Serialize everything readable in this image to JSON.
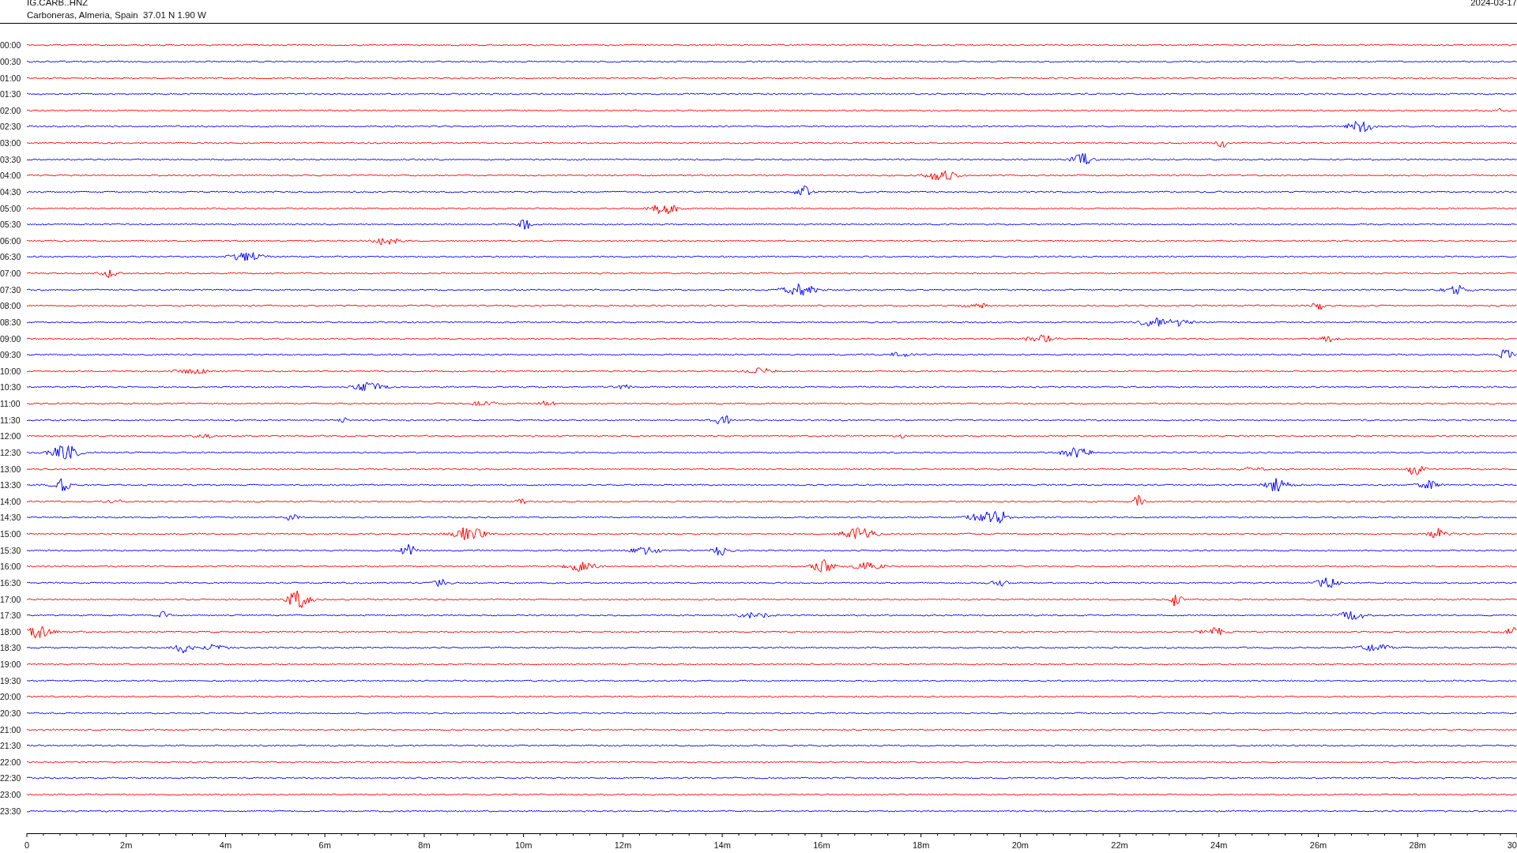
{
  "header": {
    "station": "IG.CARB..HNZ",
    "location": "Carboneras, Almeria, Spain  37.01 N 1.90 W",
    "date": "2024-03-17"
  },
  "traces": [
    {
      "time": "00:00",
      "color": "#ff0000"
    },
    {
      "time": "00:30",
      "color": "#0000ff"
    },
    {
      "time": "01:00",
      "color": "#ff0000"
    },
    {
      "time": "01:30",
      "color": "#0000ff"
    },
    {
      "time": "02:00",
      "color": "#ff0000"
    },
    {
      "time": "02:30",
      "color": "#0000ff"
    },
    {
      "time": "03:00",
      "color": "#ff0000"
    },
    {
      "time": "03:30",
      "color": "#0000ff"
    },
    {
      "time": "04:00",
      "color": "#ff0000"
    },
    {
      "time": "04:30",
      "color": "#0000ff"
    },
    {
      "time": "05:00",
      "color": "#ff0000"
    },
    {
      "time": "05:30",
      "color": "#0000ff"
    },
    {
      "time": "06:00",
      "color": "#ff0000"
    },
    {
      "time": "06:30",
      "color": "#0000ff"
    },
    {
      "time": "07:00",
      "color": "#ff0000"
    },
    {
      "time": "07:30",
      "color": "#0000ff"
    },
    {
      "time": "08:00",
      "color": "#ff0000"
    },
    {
      "time": "08:30",
      "color": "#0000ff"
    },
    {
      "time": "09:00",
      "color": "#ff0000"
    },
    {
      "time": "09:30",
      "color": "#0000ff"
    },
    {
      "time": "10:00",
      "color": "#ff0000"
    },
    {
      "time": "10:30",
      "color": "#0000ff"
    },
    {
      "time": "11:00",
      "color": "#ff0000"
    },
    {
      "time": "11:30",
      "color": "#0000ff"
    },
    {
      "time": "12:00",
      "color": "#ff0000"
    },
    {
      "time": "12:30",
      "color": "#0000ff"
    },
    {
      "time": "13:00",
      "color": "#ff0000"
    },
    {
      "time": "13:30",
      "color": "#0000ff"
    },
    {
      "time": "14:00",
      "color": "#ff0000"
    },
    {
      "time": "14:30",
      "color": "#0000ff"
    },
    {
      "time": "15:00",
      "color": "#ff0000"
    },
    {
      "time": "15:30",
      "color": "#0000ff"
    },
    {
      "time": "16:00",
      "color": "#ff0000"
    },
    {
      "time": "16:30",
      "color": "#0000ff"
    },
    {
      "time": "17:00",
      "color": "#ff0000"
    },
    {
      "time": "17:30",
      "color": "#0000ff"
    },
    {
      "time": "18:00",
      "color": "#ff0000"
    },
    {
      "time": "18:30",
      "color": "#0000ff"
    },
    {
      "time": "19:00",
      "color": "#ff0000"
    },
    {
      "time": "19:30",
      "color": "#0000ff"
    },
    {
      "time": "20:00",
      "color": "#ff0000"
    },
    {
      "time": "20:30",
      "color": "#0000ff"
    },
    {
      "time": "21:00",
      "color": "#ff0000"
    },
    {
      "time": "21:30",
      "color": "#0000ff"
    },
    {
      "time": "22:00",
      "color": "#ff0000"
    },
    {
      "time": "22:30",
      "color": "#0000ff"
    },
    {
      "time": "23:00",
      "color": "#ff0000"
    },
    {
      "time": "23:30",
      "color": "#0000ff"
    }
  ],
  "axis": {
    "ticks": [
      "0",
      "2m",
      "4m",
      "6m",
      "8m",
      "10m",
      "12m",
      "14m",
      "16m",
      "18m",
      "20m",
      "22m",
      "24m",
      "26m",
      "28m",
      "30"
    ]
  }
}
